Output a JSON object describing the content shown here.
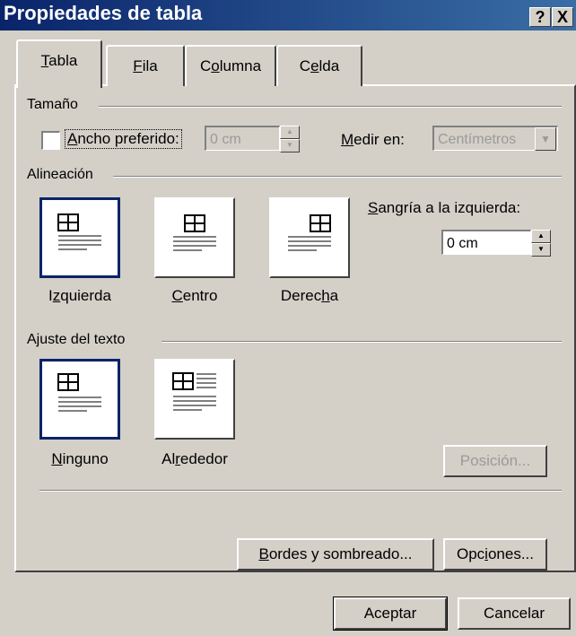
{
  "window": {
    "title": "Propiedades de tabla",
    "help_label": "?",
    "close_label": "X"
  },
  "tabs": [
    {
      "pre": "",
      "key": "T",
      "post": "abla",
      "active": true
    },
    {
      "pre": "",
      "key": "F",
      "post": "ila",
      "active": false
    },
    {
      "pre": "C",
      "key": "o",
      "post": "lumna",
      "active": false
    },
    {
      "pre": "C",
      "key": "e",
      "post": "lda",
      "active": false
    }
  ],
  "size_group": {
    "label": "Tamaño",
    "preferred_width": {
      "key": "A",
      "post": "ncho preferido:",
      "checked": false
    },
    "width_value": "0 cm",
    "measure_label_key": "M",
    "measure_label_post": "edir en:",
    "measure_value": "Centímetros"
  },
  "alignment_group": {
    "label": "Alineación",
    "options": [
      {
        "pre": "I",
        "key": "z",
        "post": "quierda",
        "selected": true
      },
      {
        "pre": "",
        "key": "C",
        "post": "entro",
        "selected": false
      },
      {
        "pre": "Derec",
        "key": "h",
        "post": "a",
        "selected": false
      }
    ],
    "indent_label_key": "S",
    "indent_label_post": "angría a la izquierda:",
    "indent_value": "0 cm"
  },
  "wrap_group": {
    "label": "Ajuste del texto",
    "options": [
      {
        "pre": "",
        "key": "N",
        "post": "inguno",
        "selected": true
      },
      {
        "pre": "Al",
        "key": "r",
        "post": "ededor",
        "selected": false
      }
    ],
    "position_button": "Posición..."
  },
  "buttons": {
    "borders_key": "B",
    "borders_post": "ordes y sombreado...",
    "options_pre": "Opc",
    "options_key": "i",
    "options_post": "ones...",
    "accept": "Aceptar",
    "cancel": "Cancelar"
  },
  "icons": {
    "help": "help-icon",
    "close": "close-icon",
    "spin_up": "spin-up-icon",
    "spin_down": "spin-down-icon",
    "dropdown": "chevron-down-icon"
  }
}
